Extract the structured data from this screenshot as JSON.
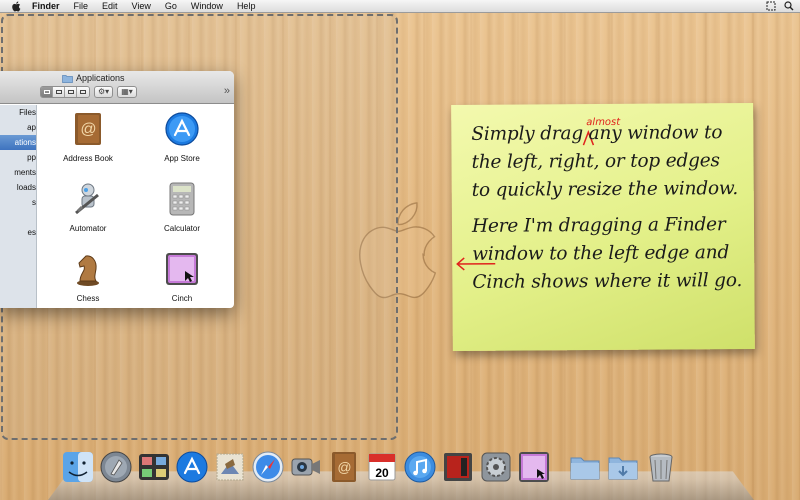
{
  "menubar": {
    "app_name": "Finder",
    "items": [
      "File",
      "Edit",
      "View",
      "Go",
      "Window",
      "Help"
    ]
  },
  "finder": {
    "title": "Applications",
    "sidebar": [
      "Files",
      "ap",
      "ations",
      "pp",
      "ments",
      "loads",
      "s",
      "",
      "es"
    ],
    "sidebar_selected": 2,
    "view_dropdown_symbol": "▾",
    "more_symbol": "»",
    "apps": [
      {
        "label": "Address Book",
        "icon": "address-book-icon"
      },
      {
        "label": "App Store",
        "icon": "app-store-icon"
      },
      {
        "label": "Automator",
        "icon": "automator-icon"
      },
      {
        "label": "Calculator",
        "icon": "calculator-icon"
      },
      {
        "label": "Chess",
        "icon": "chess-icon"
      },
      {
        "label": "Cinch",
        "icon": "cinch-icon"
      }
    ]
  },
  "sticky": {
    "line1": "Simply drag any window to",
    "line2": "the left, right, or top edges",
    "line3": "to quickly resize the window.",
    "line4": "Here I'm dragging a Finder",
    "line5": "window to the left edge and",
    "line6": "Cinch shows where it will go.",
    "insert": "almost"
  },
  "dock": {
    "calendar_day": "20",
    "items": [
      "finder-icon",
      "launchpad-icon",
      "mission-control-icon",
      "app-store-icon",
      "mail-icon",
      "safari-icon",
      "facetime-icon",
      "address-book-icon",
      "ical-icon",
      "itunes-icon",
      "photo-booth-icon",
      "system-preferences-icon",
      "cinch-icon",
      "applications-folder-icon",
      "downloads-folder-icon",
      "trash-icon"
    ]
  },
  "colors": {
    "sticky_bg": "#e6f28e",
    "note_red": "#e0231d",
    "selection_blue": "#3e73bf"
  }
}
